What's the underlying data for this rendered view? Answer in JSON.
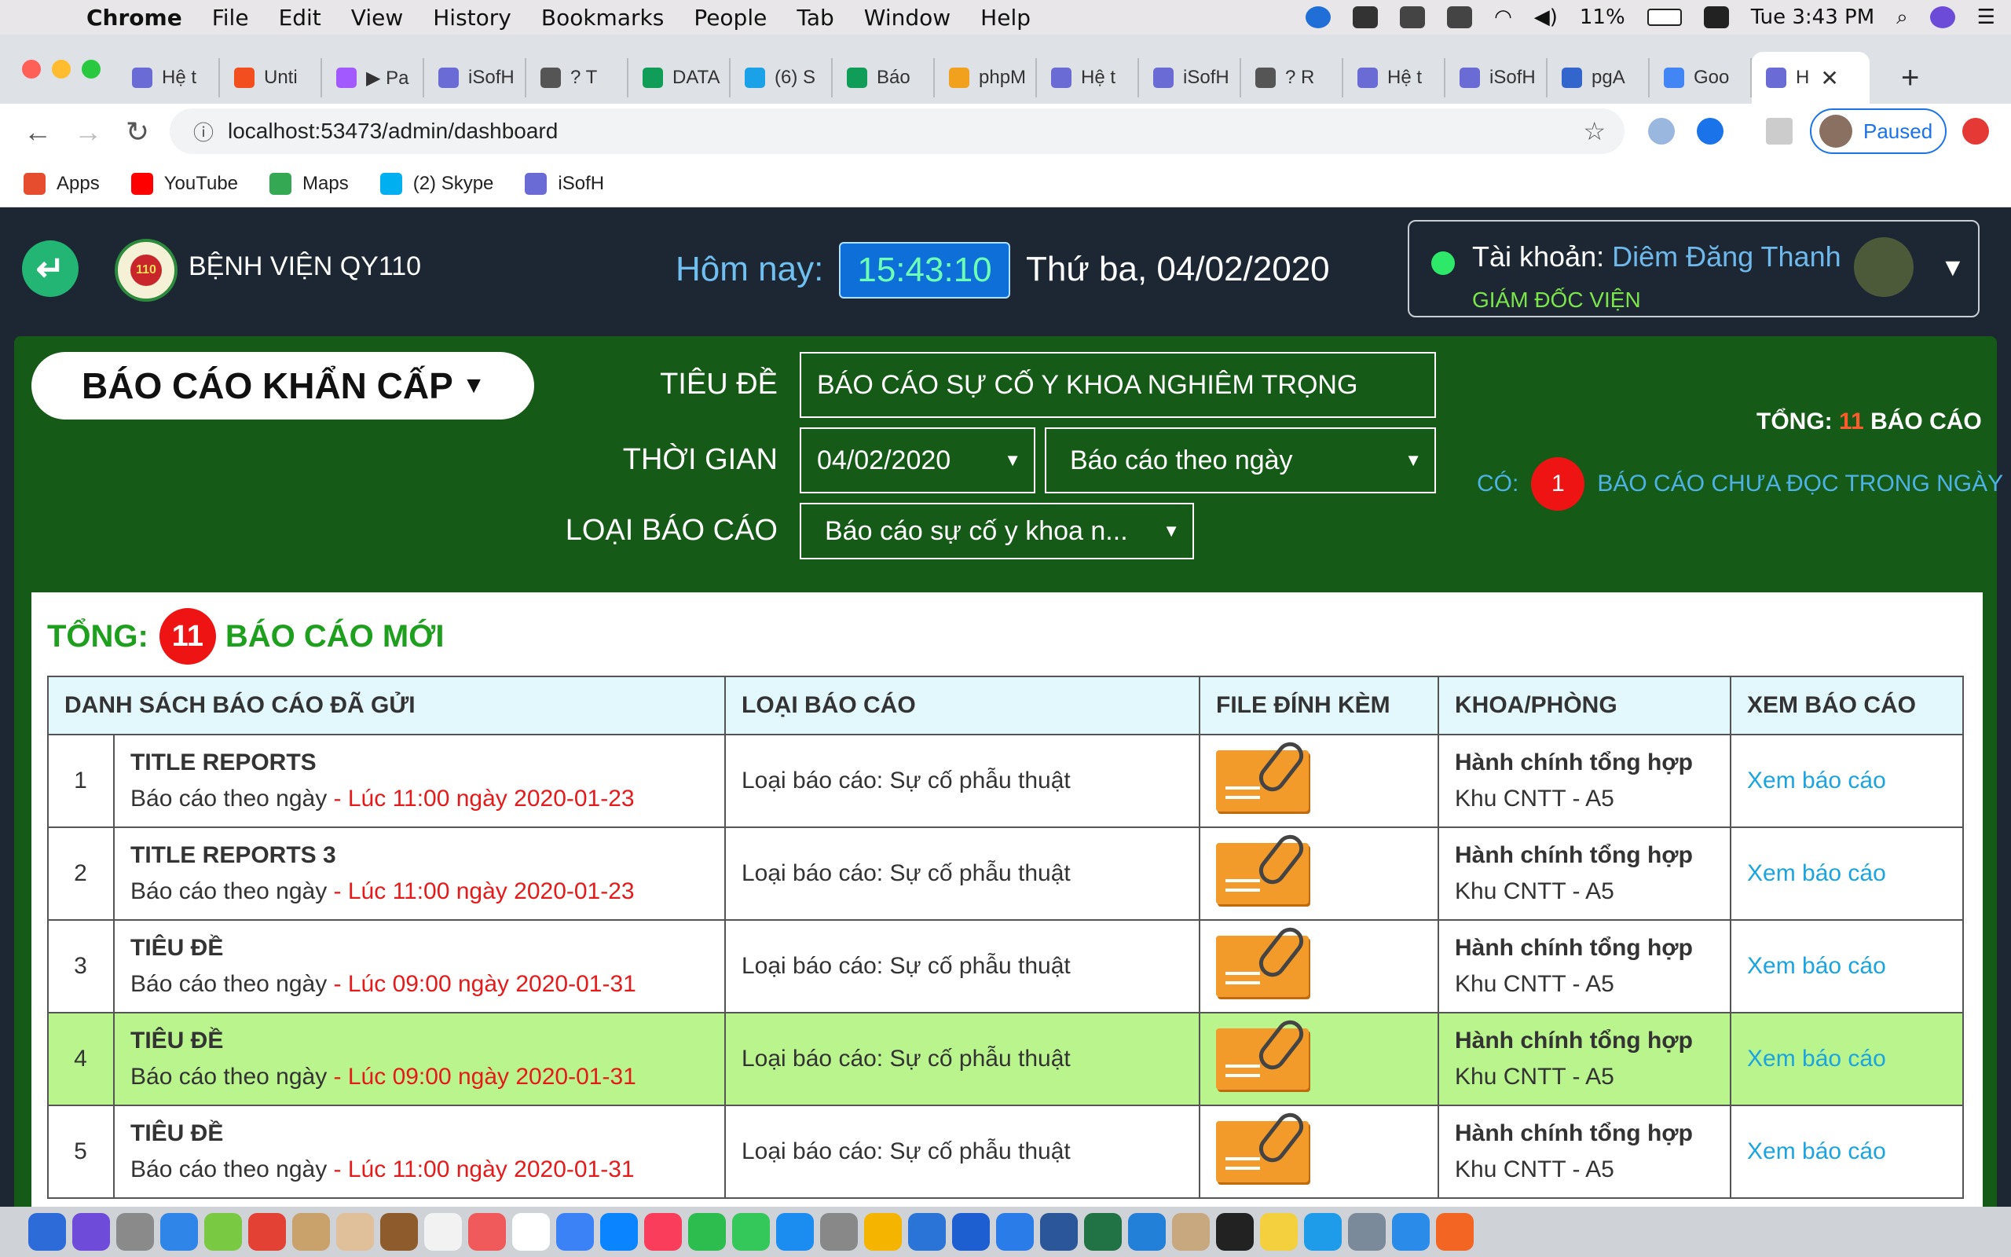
{
  "menubar": {
    "app": "Chrome",
    "items": [
      "File",
      "Edit",
      "View",
      "History",
      "Bookmarks",
      "People",
      "Tab",
      "Window",
      "Help"
    ],
    "battery": "11%",
    "clock": "Tue 3:43 PM"
  },
  "tabs": [
    {
      "label": "Hệ t",
      "color": "#6b6bd6"
    },
    {
      "label": "Unti",
      "color": "#f24e1e"
    },
    {
      "label": "▶ Pa",
      "color": "#a259ff"
    },
    {
      "label": "iSofH",
      "color": "#6b6bd6"
    },
    {
      "label": "? T",
      "color": "#555555"
    },
    {
      "label": "DATA",
      "color": "#0f9d58"
    },
    {
      "label": "(6) S",
      "color": "#1aa1e8"
    },
    {
      "label": "Báo",
      "color": "#0f9d58"
    },
    {
      "label": "phpM",
      "color": "#f2a11e"
    },
    {
      "label": "Hệ t",
      "color": "#6b6bd6"
    },
    {
      "label": "iSofH",
      "color": "#6b6bd6"
    },
    {
      "label": "? R",
      "color": "#555555"
    },
    {
      "label": "Hệ t",
      "color": "#6b6bd6"
    },
    {
      "label": "iSofH",
      "color": "#6b6bd6"
    },
    {
      "label": "pgA",
      "color": "#3366cc"
    },
    {
      "label": "Goo",
      "color": "#4285f4"
    },
    {
      "label": "H",
      "color": "#6b6bd6",
      "active": true
    }
  ],
  "address": {
    "url": "localhost:53473/admin/dashboard",
    "profile_label": "Paused"
  },
  "bookmarks": [
    {
      "label": "Apps",
      "color": "#e54d2e"
    },
    {
      "label": "YouTube",
      "color": "#ff0000"
    },
    {
      "label": "Maps",
      "color": "#34a853"
    },
    {
      "label": "(2) Skype",
      "color": "#00aff0"
    },
    {
      "label": "iSofH",
      "color": "#6b6bd6"
    }
  ],
  "header": {
    "hospital": "BỆNH VIỆN QY110",
    "logo_text": "110",
    "today_label": "Hôm nay:",
    "time": "15:43:10",
    "date": "Thứ ba, 04/02/2020",
    "account_label": "Tài khoản:",
    "account_name": "Diêm Đăng Thanh",
    "account_role": "GIÁM ĐỐC VIỆN"
  },
  "filters": {
    "report_type_pill": "BÁO CÁO KHẨN CẤP",
    "title_label": "TIÊU ĐỀ",
    "title_value": "BÁO CÁO SỰ CỐ Y KHOA NGHIÊM TRỌNG",
    "time_label": "THỜI GIAN",
    "date_value": "04/02/2020",
    "period_value": "Báo cáo theo ngày",
    "category_label": "LOẠI BÁO CÁO",
    "category_value": "Báo cáo sự cố y khoa n..."
  },
  "summary": {
    "total_prefix": "TỔNG:",
    "total_count": "11",
    "total_suffix": "BÁO CÁO",
    "unread_prefix": "CÓ:",
    "unread_count": "1",
    "unread_suffix": "BÁO CÁO CHƯA ĐỌC TRONG NGÀY"
  },
  "card": {
    "title_prefix": "TỔNG:",
    "title_count": "11",
    "title_suffix": "BÁO CÁO MỚI"
  },
  "table": {
    "headers": [
      "DANH SÁCH BÁO CÁO ĐÃ GỬI",
      "LOẠI BÁO CÁO",
      "FILE ĐÍNH KÈM",
      "KHOA/PHÒNG",
      "XEM BÁO CÁO"
    ],
    "rows": [
      {
        "idx": "1",
        "title": "TITLE REPORTS",
        "sub": "Báo cáo theo ngày",
        "time": " - Lúc 11:00 ngày 2020-01-23",
        "type": "Loại báo cáo: Sự cố phẫu thuật",
        "dept": "Hành chính tổng hợp",
        "room": "Khu CNTT - A5",
        "view": "Xem báo cáo"
      },
      {
        "idx": "2",
        "title": "TITLE REPORTS 3",
        "sub": "Báo cáo theo ngày",
        "time": " - Lúc 11:00 ngày 2020-01-23",
        "type": "Loại báo cáo: Sự cố phẫu thuật",
        "dept": "Hành chính tổng hợp",
        "room": "Khu CNTT - A5",
        "view": "Xem báo cáo"
      },
      {
        "idx": "3",
        "title": "TIÊU ĐỀ",
        "sub": "Báo cáo theo ngày",
        "time": " - Lúc 09:00 ngày 2020-01-31",
        "type": "Loại báo cáo: Sự cố phẫu thuật",
        "dept": "Hành chính tổng hợp",
        "room": "Khu CNTT - A5",
        "view": "Xem báo cáo"
      },
      {
        "idx": "4",
        "title": "TIÊU ĐỀ",
        "sub": "Báo cáo theo ngày",
        "time": " - Lúc 09:00 ngày 2020-01-31",
        "type": "Loại báo cáo: Sự cố phẫu thuật",
        "dept": "Hành chính tổng hợp",
        "room": "Khu CNTT - A5",
        "view": "Xem báo cáo",
        "highlight": true
      },
      {
        "idx": "5",
        "title": "TIÊU ĐỀ",
        "sub": "Báo cáo theo ngày",
        "time": " - Lúc 11:00 ngày 2020-01-31",
        "type": "Loại báo cáo: Sự cố phẫu thuật",
        "dept": "Hành chính tổng hợp",
        "room": "Khu CNTT - A5",
        "view": "Xem báo cáo"
      }
    ]
  },
  "dock_colors": [
    "#2d6bd9",
    "#6e4bd8",
    "#8a8a8a",
    "#2f86e8",
    "#7ac943",
    "#e34133",
    "#c9a26b",
    "#e0c09a",
    "#8e5c2c",
    "#f2f2f2",
    "#f05a5a",
    "#ffffff",
    "#3b82f6",
    "#0a84ff",
    "#fa3d5b",
    "#2dbd4e",
    "#34c759",
    "#1b8cf0",
    "#888888",
    "#f5b400",
    "#2a74d8",
    "#1d5fd0",
    "#2a7ce8",
    "#2b579a",
    "#217346",
    "#2380d8",
    "#c8a87e",
    "#222222",
    "#f4d03f",
    "#1e9be9",
    "#7b8a9a",
    "#2a8be8",
    "#f26522"
  ]
}
